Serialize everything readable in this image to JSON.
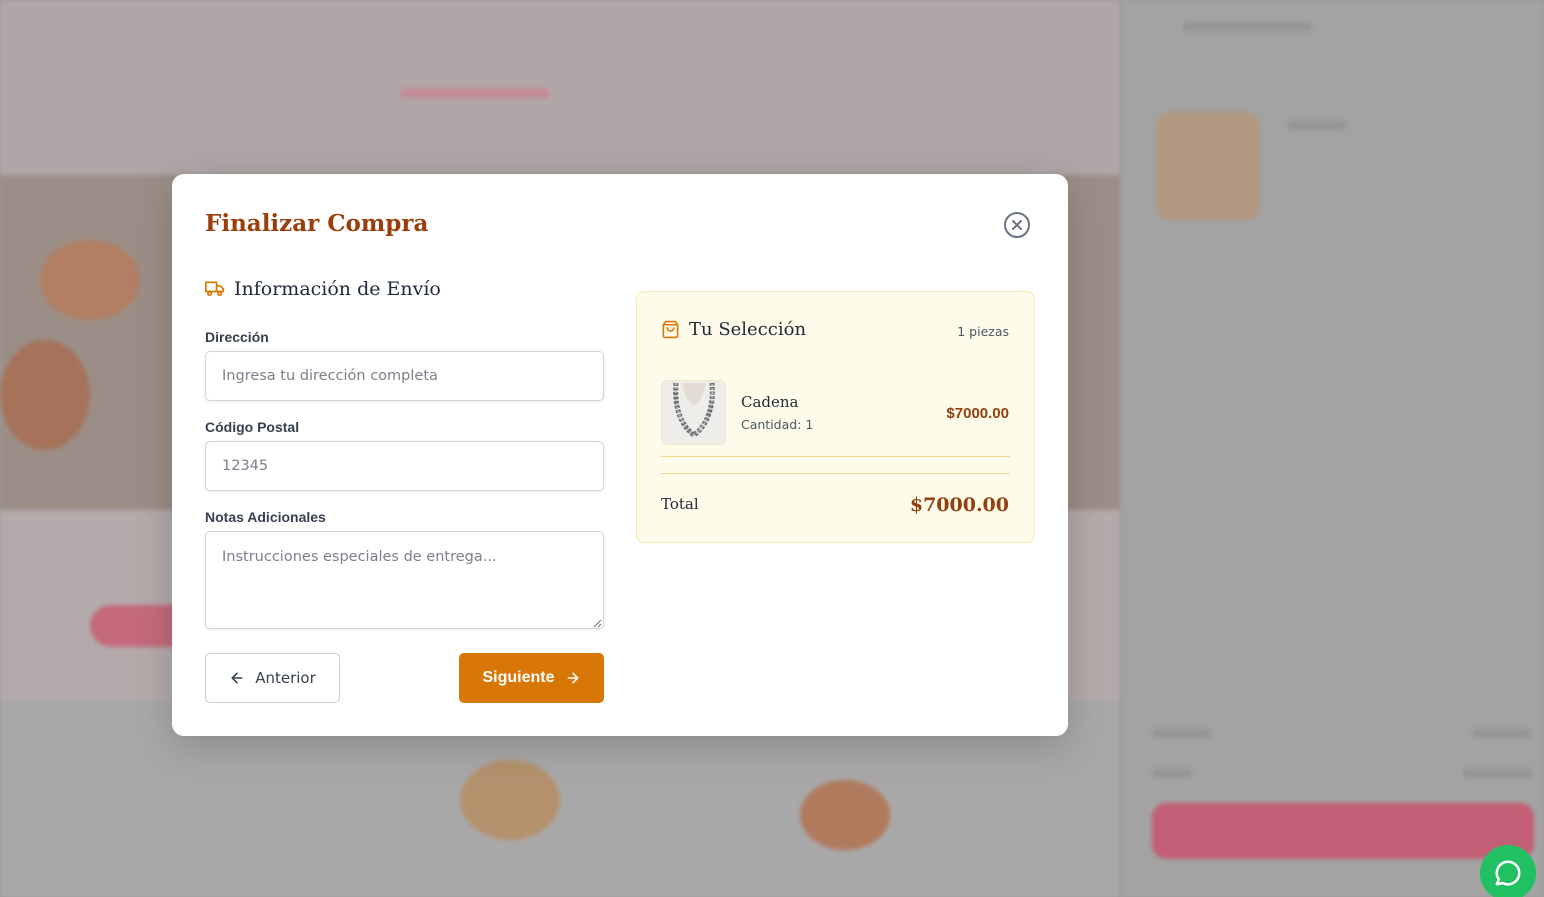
{
  "modal": {
    "title": "Finalizar Compra",
    "close_icon": "close-circle-icon"
  },
  "shipping": {
    "heading": "Información de Envío",
    "icon": "truck-icon",
    "fields": {
      "address": {
        "label": "Dirección",
        "placeholder": "Ingresa tu dirección completa",
        "value": ""
      },
      "postal_code": {
        "label": "Código Postal",
        "placeholder": "12345",
        "value": ""
      },
      "notes": {
        "label": "Notas Adicionales",
        "placeholder": "Instrucciones especiales de entrega...",
        "value": ""
      }
    }
  },
  "actions": {
    "prev_label": "Anterior",
    "next_label": "Siguiente"
  },
  "summary": {
    "heading": "Tu Selección",
    "icon": "shopping-bag-icon",
    "piece_count": "1 piezas",
    "items": [
      {
        "name": "Cadena",
        "quantity": "Cantidad: 1",
        "price": "$7000.00",
        "image": "necklace-thumbnail"
      }
    ],
    "total_label": "Total",
    "total_value": "$7000.00"
  },
  "colors": {
    "accent": "#d97706",
    "title": "#9a3f0c",
    "price": "#92400e",
    "summary_bg": "#fefbea",
    "whatsapp": "#21c063"
  },
  "floating": {
    "icon": "whatsapp-icon"
  }
}
